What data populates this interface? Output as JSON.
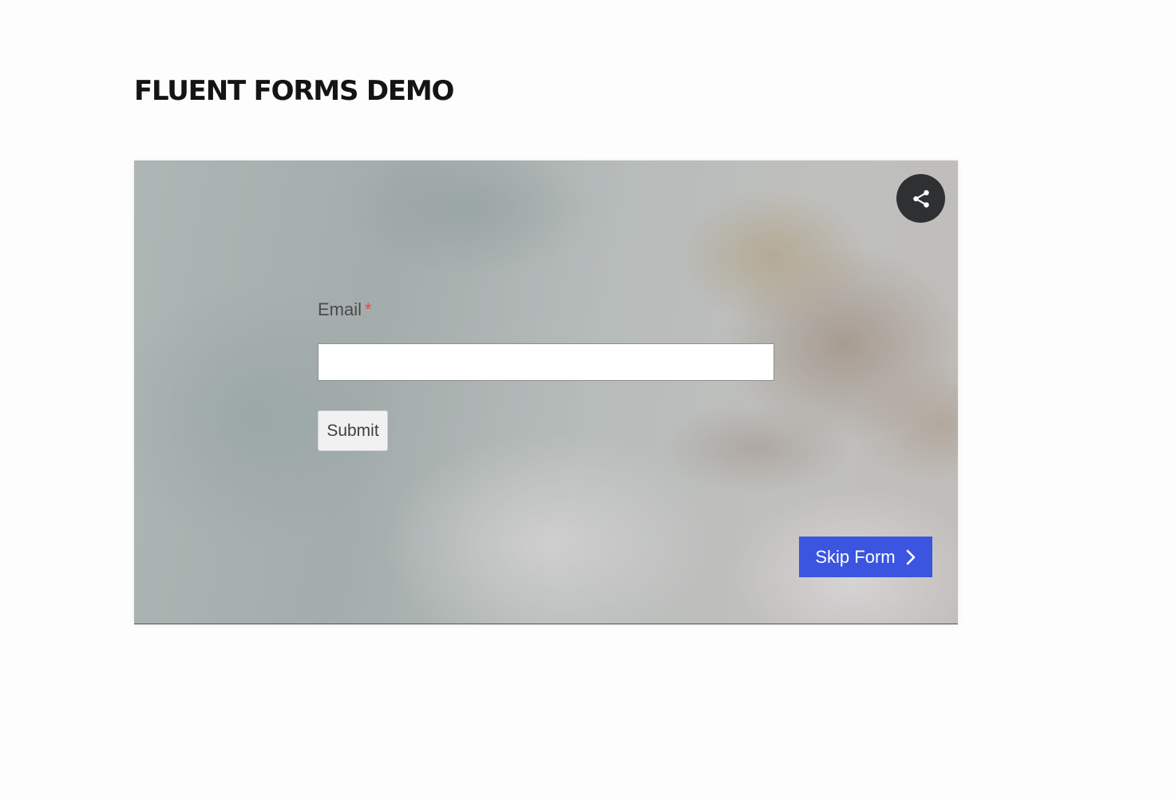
{
  "page": {
    "title": "FLUENT FORMS DEMO"
  },
  "form": {
    "email_label": "Email",
    "required_mark": "*",
    "email_value": "",
    "email_placeholder": "",
    "submit_label": "Submit",
    "skip_label": "Skip Form"
  },
  "icons": {
    "share": "share-icon",
    "skip": "chevron-right-icon"
  },
  "colors": {
    "title": "#141414",
    "skip_button": "#3b55e0",
    "share_button": "#2e3032",
    "required_mark": "#e04b4b"
  }
}
